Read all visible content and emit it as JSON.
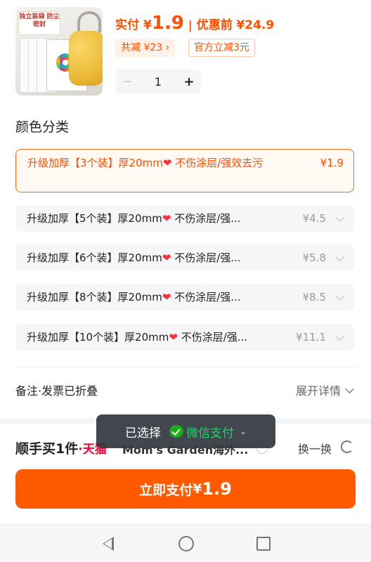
{
  "product": {
    "image_text": "独立装袋 防尘密封",
    "price_label": "实付",
    "currency": "¥",
    "price": "1.9",
    "separator": "|",
    "original_label": "优惠前",
    "original_price": "¥24.9",
    "discount_tag": "共减 ¥23",
    "discount_chevron": "›",
    "official_tag": "官方立减3元",
    "quantity": "1",
    "minus": "−",
    "plus": "+"
  },
  "variants": {
    "title": "颜色分类",
    "options": [
      {
        "name_a": "升级加厚【3个装】厚20mm",
        "name_b": " 不伤涂层/强效去污",
        "price": "¥1.9",
        "selected": true
      },
      {
        "name_a": "升级加厚【5个装】厚20mm",
        "name_b": " 不伤涂层/强...",
        "price": "¥4.5",
        "selected": false
      },
      {
        "name_a": "升级加厚【6个装】厚20mm",
        "name_b": " 不伤涂层/强...",
        "price": "¥5.8",
        "selected": false
      },
      {
        "name_a": "升级加厚【8个装】厚20mm",
        "name_b": " 不伤涂层/强...",
        "price": "¥8.5",
        "selected": false
      },
      {
        "name_a": "升级加厚【10个装】厚20mm",
        "name_b": " 不伤涂层/强...",
        "price": "¥11.1",
        "selected": false
      }
    ],
    "heart": "❤"
  },
  "remark": {
    "label": "备注·发票已折叠",
    "expand": "展开详情"
  },
  "shop": {
    "brand": "顺手买1件",
    "dot": "·",
    "tmall": "天猫",
    "store_name": "Mom's Garden海外...",
    "info": "!",
    "swap": "换一换"
  },
  "toast": {
    "selected": "已选择",
    "method": "微信支付",
    "chevron": "⌄"
  },
  "pay_button": {
    "label": "立即支付",
    "currency": "¥",
    "amount": "1.9"
  },
  "colors": {
    "accent": "#ff5000",
    "button": "#ff5a00",
    "wechat": "#1aad19"
  }
}
